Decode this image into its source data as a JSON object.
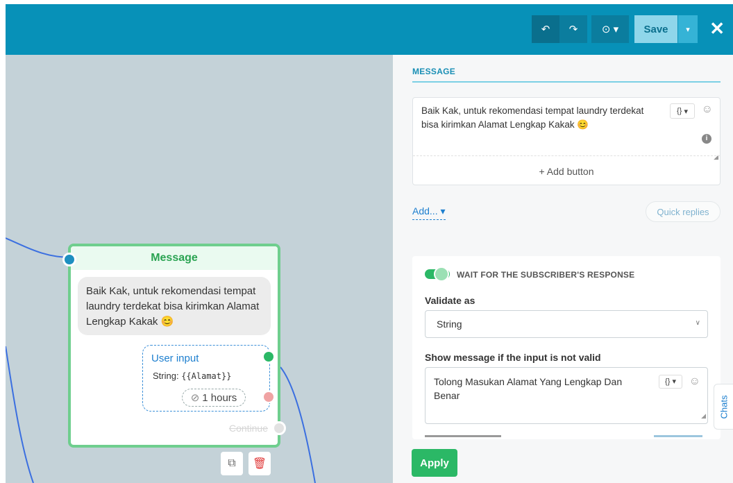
{
  "toolbar": {
    "undo_icon": "undo-icon",
    "redo_icon": "redo-icon",
    "history_icon": "history-icon",
    "save_label": "Save",
    "close_icon": "close-icon",
    "accent_color": "#0791b8"
  },
  "canvas": {
    "node": {
      "title": "Message",
      "message_text": "Baik Kak, untuk rekomendasi tempat laundry terdekat bisa kirimkan Alamat Lengkap Kakak 😊",
      "user_input_title": "User input",
      "user_input_type": "String:",
      "user_input_var": "{{Alamat}}",
      "timeout": "1 hours",
      "continue_label": "Continue"
    }
  },
  "panel": {
    "section_title": "MESSAGE",
    "message_text": "Baik Kak, untuk rekomendasi tempat laundry terdekat bisa kirimkan Alamat Lengkap Kakak 😊",
    "add_button_label": "+ Add button",
    "add_menu_label": "Add...",
    "quick_replies_label": "Quick replies",
    "wait_label": "WAIT FOR THE SUBSCRIBER'S RESPONSE",
    "validate_label": "Validate as",
    "validate_value": "String",
    "invalid_label": "Show message if the input is not valid",
    "invalid_message": "Tolong Masukan Alamat Yang Lengkap Dan Benar",
    "apply_label": "Apply",
    "chats_label": "Chats",
    "var_button": "{}"
  }
}
